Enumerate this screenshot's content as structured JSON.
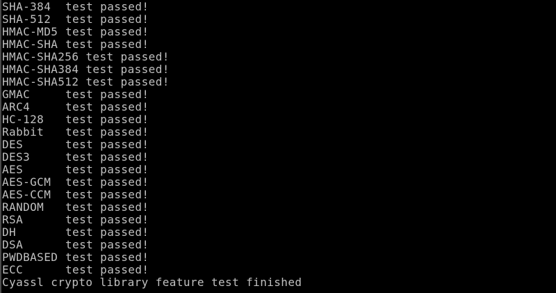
{
  "console": {
    "results": [
      {
        "name": "SHA-384",
        "status": "test passed!"
      },
      {
        "name": "SHA-512",
        "status": "test passed!"
      },
      {
        "name": "HMAC-MD5",
        "status": "test passed!"
      },
      {
        "name": "HMAC-SHA",
        "status": "test passed!"
      },
      {
        "name": "HMAC-SHA256",
        "status": "test passed!"
      },
      {
        "name": "HMAC-SHA384",
        "status": "test passed!"
      },
      {
        "name": "HMAC-SHA512",
        "status": "test passed!"
      },
      {
        "name": "GMAC",
        "status": "test passed!"
      },
      {
        "name": "ARC4",
        "status": "test passed!"
      },
      {
        "name": "HC-128",
        "status": "test passed!"
      },
      {
        "name": "Rabbit",
        "status": "test passed!"
      },
      {
        "name": "DES",
        "status": "test passed!"
      },
      {
        "name": "DES3",
        "status": "test passed!"
      },
      {
        "name": "AES",
        "status": "test passed!"
      },
      {
        "name": "AES-GCM",
        "status": "test passed!"
      },
      {
        "name": "AES-CCM",
        "status": "test passed!"
      },
      {
        "name": "RANDOM",
        "status": "test passed!"
      },
      {
        "name": "RSA",
        "status": "test passed!"
      },
      {
        "name": "DH",
        "status": "test passed!"
      },
      {
        "name": "DSA",
        "status": "test passed!"
      },
      {
        "name": "PWDBASED",
        "status": "test passed!"
      },
      {
        "name": "ECC",
        "status": "test passed!"
      }
    ],
    "finish_message": "Cyassl crypto library feature test finished"
  }
}
